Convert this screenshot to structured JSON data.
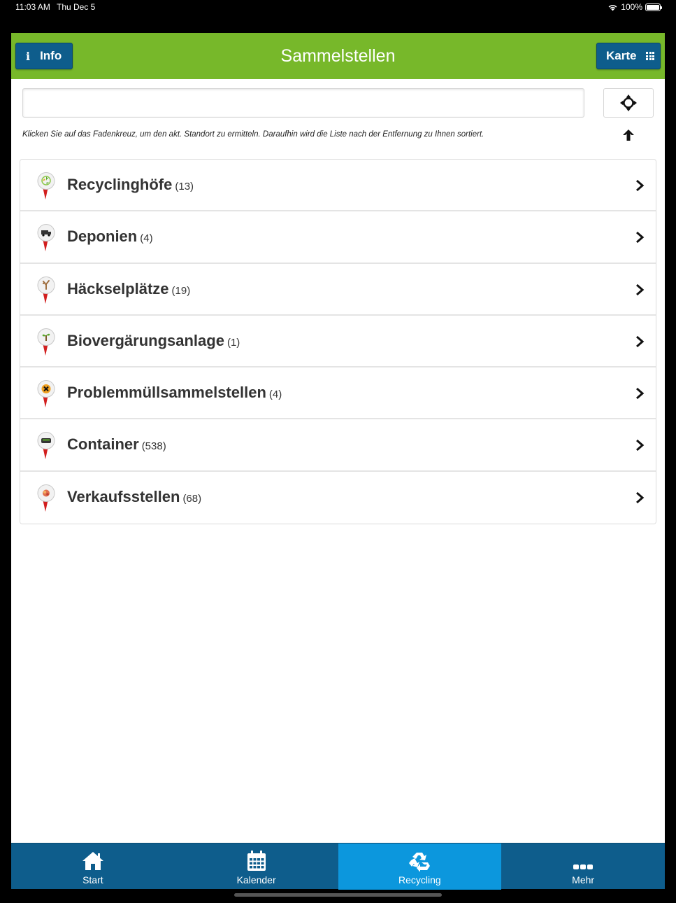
{
  "status_bar": {
    "time": "11:03 AM",
    "date": "Thu Dec 5",
    "battery": "100%"
  },
  "header": {
    "title": "Sammelstellen",
    "info_label": "Info",
    "karte_label": "Karte",
    "color": "#77b82a",
    "button_color": "#0e5d8c"
  },
  "search": {
    "value": "",
    "placeholder": ""
  },
  "hint": "Klicken Sie auf das Fadenkreuz, um den akt. Standort zu ermitteln. Daraufhin wird die Liste nach der Entfernung zu Ihnen sortiert.",
  "categories": [
    {
      "label": "Recyclinghöfe",
      "count": "(13)",
      "icon": "recycling-pin-icon"
    },
    {
      "label": "Deponien",
      "count": "(4)",
      "icon": "truck-pin-icon"
    },
    {
      "label": "Häckselplätze",
      "count": "(19)",
      "icon": "branch-pin-icon"
    },
    {
      "label": "Biovergärungsanlage",
      "count": "(1)",
      "icon": "plant-pin-icon"
    },
    {
      "label": "Problemmüllsammelstellen",
      "count": "(4)",
      "icon": "hazard-pin-icon"
    },
    {
      "label": "Container",
      "count": "(538)",
      "icon": "container-pin-icon"
    },
    {
      "label": "Verkaufsstellen",
      "count": "(68)",
      "icon": "shop-pin-icon"
    }
  ],
  "tabs": [
    {
      "label": "Start",
      "icon": "home-icon",
      "active": false
    },
    {
      "label": "Kalender",
      "icon": "calendar-icon",
      "active": false
    },
    {
      "label": "Recycling",
      "icon": "recycle-icon",
      "active": true
    },
    {
      "label": "Mehr",
      "icon": "more-dots-icon",
      "active": false
    }
  ],
  "tab_colors": {
    "bar": "#0e5d8c",
    "active": "#0c97dd"
  }
}
